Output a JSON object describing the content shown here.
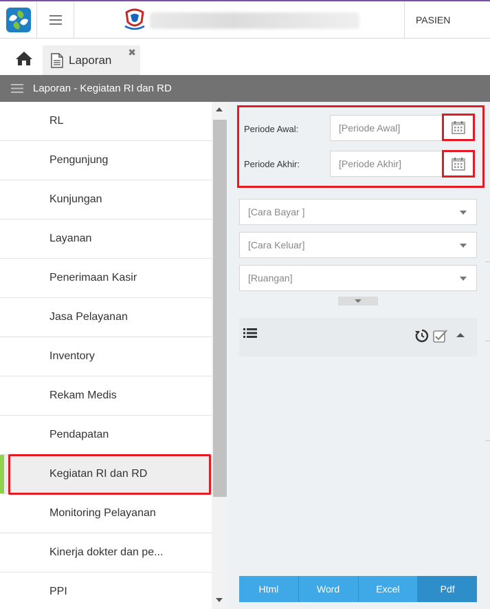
{
  "header": {
    "user_label": "PASIEN"
  },
  "tabs": [
    {
      "label": "Laporan"
    }
  ],
  "section": {
    "title": "Laporan - Kegiatan RI dan RD"
  },
  "menu": {
    "items": [
      {
        "label": "RL"
      },
      {
        "label": "Pengunjung"
      },
      {
        "label": "Kunjungan"
      },
      {
        "label": "Layanan"
      },
      {
        "label": "Penerimaan Kasir"
      },
      {
        "label": "Jasa Pelayanan"
      },
      {
        "label": "Inventory"
      },
      {
        "label": "Rekam Medis"
      },
      {
        "label": "Pendapatan"
      },
      {
        "label": "Kegiatan RI dan RD"
      },
      {
        "label": "Monitoring Pelayanan"
      },
      {
        "label": "Kinerja dokter dan pe..."
      },
      {
        "label": "PPI"
      }
    ],
    "active_index": 9
  },
  "filters": {
    "periode_awal_label": "Periode Awal:",
    "periode_awal_placeholder": "[Periode Awal]",
    "periode_akhir_label": "Periode Akhir:",
    "periode_akhir_placeholder": "[Periode Akhir]",
    "cara_bayar": "[Cara Bayar ]",
    "cara_keluar": "[Cara Keluar]",
    "ruangan": "[Ruangan]"
  },
  "export": {
    "html": "Html",
    "word": "Word",
    "excel": "Excel",
    "pdf": "Pdf"
  },
  "colors": {
    "section_bar": "#727272",
    "highlight": "#e51b23",
    "active_marker": "#8fd34c",
    "export_button": "#3fa8e6",
    "export_button_active": "#2d8ec9"
  },
  "icons": {
    "app_logo": "app-logo-icon",
    "menu": "hamburger-icon",
    "home": "home-icon",
    "document": "document-icon",
    "close": "close-icon",
    "calendar": "calendar-icon",
    "list": "list-icon",
    "history": "history-icon",
    "check": "checkbox-icon"
  }
}
